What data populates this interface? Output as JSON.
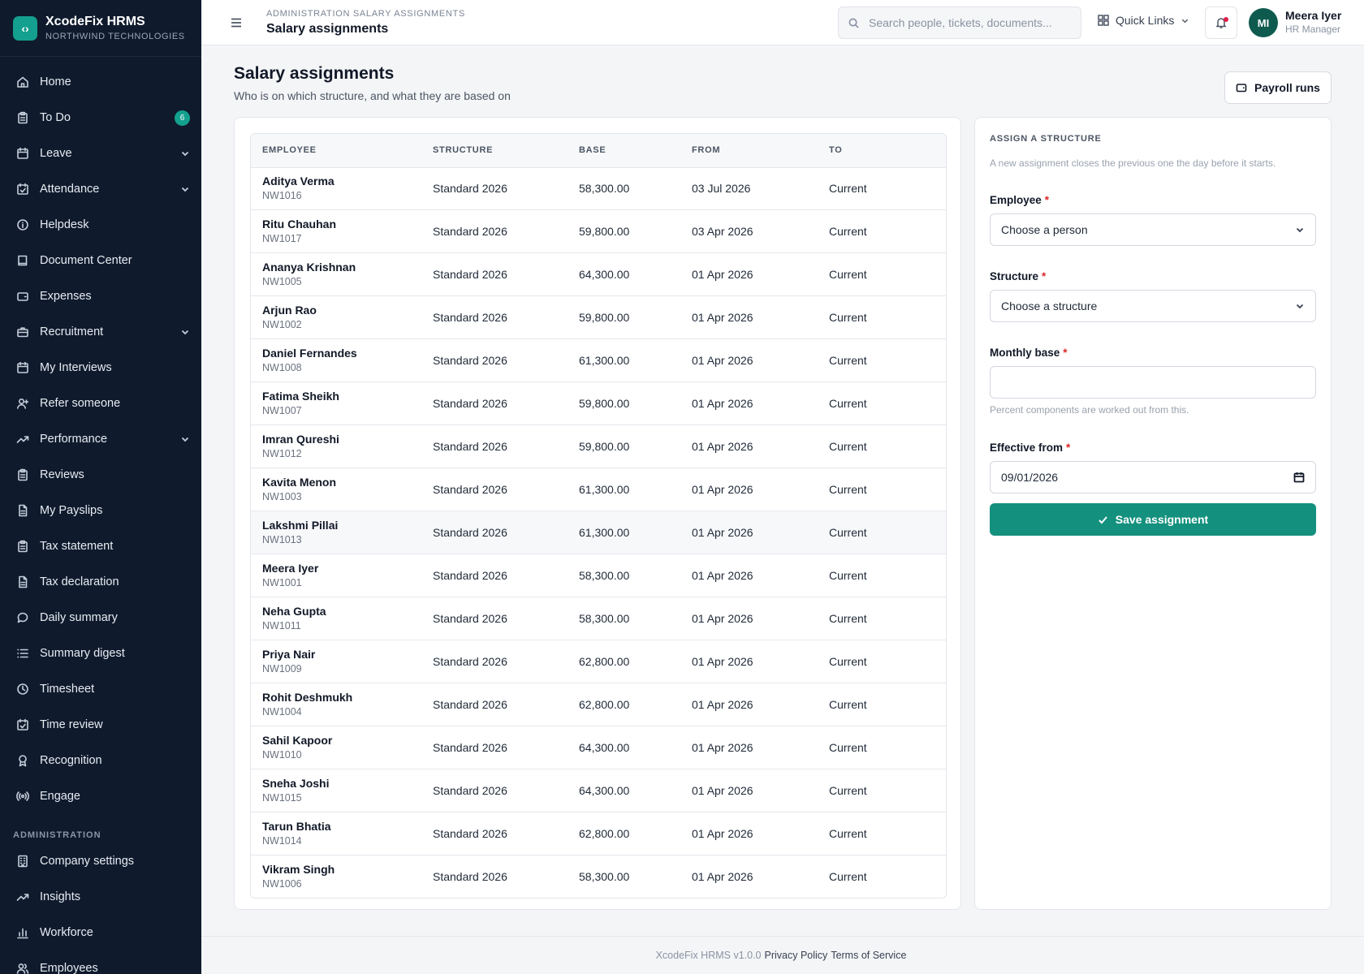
{
  "brand": {
    "name": "XcodeFix HRMS",
    "company": "NORTHWIND TECHNOLOGIES"
  },
  "sidebar": {
    "items": [
      {
        "label": "Home",
        "icon": "home-icon"
      },
      {
        "label": "To Do",
        "icon": "clipboard-icon",
        "badge": "6"
      },
      {
        "label": "Leave",
        "icon": "calendar-icon",
        "expandable": true
      },
      {
        "label": "Attendance",
        "icon": "calendar-check-icon",
        "expandable": true
      },
      {
        "label": "Helpdesk",
        "icon": "info-icon"
      },
      {
        "label": "Document Center",
        "icon": "book-icon"
      },
      {
        "label": "Expenses",
        "icon": "wallet-icon"
      },
      {
        "label": "Recruitment",
        "icon": "briefcase-icon",
        "expandable": true
      },
      {
        "label": "My Interviews",
        "icon": "calendar-icon"
      },
      {
        "label": "Refer someone",
        "icon": "user-plus-icon"
      },
      {
        "label": "Performance",
        "icon": "trending-up-icon",
        "expandable": true
      },
      {
        "label": "Reviews",
        "icon": "clipboard-icon"
      },
      {
        "label": "My Payslips",
        "icon": "file-icon"
      },
      {
        "label": "Tax statement",
        "icon": "clipboard-icon"
      },
      {
        "label": "Tax declaration",
        "icon": "file-icon"
      },
      {
        "label": "Daily summary",
        "icon": "chat-bubble-icon"
      },
      {
        "label": "Summary digest",
        "icon": "list-icon"
      },
      {
        "label": "Timesheet",
        "icon": "clock-icon"
      },
      {
        "label": "Time review",
        "icon": "calendar-check-icon"
      },
      {
        "label": "Recognition",
        "icon": "award-icon"
      },
      {
        "label": "Engage",
        "icon": "broadcast-icon"
      }
    ],
    "admin_section": "ADMINISTRATION",
    "admin_items": [
      {
        "label": "Company settings",
        "icon": "building-icon"
      },
      {
        "label": "Insights",
        "icon": "trending-up-icon"
      },
      {
        "label": "Workforce",
        "icon": "bar-chart-icon"
      },
      {
        "label": "Employees",
        "icon": "users-icon"
      }
    ]
  },
  "header": {
    "breadcrumb": "ADMINISTRATION SALARY ASSIGNMENTS",
    "title": "Salary assignments",
    "search_placeholder": "Search people, tickets, documents...",
    "quick_links": "Quick Links",
    "user": {
      "initials": "MI",
      "name": "Meera Iyer",
      "role": "HR Manager"
    }
  },
  "main": {
    "title": "Salary assignments",
    "subtitle": "Who is on which structure, and what they are based on",
    "payroll_button": "Payroll runs",
    "table": {
      "columns": [
        "EMPLOYEE",
        "STRUCTURE",
        "BASE",
        "FROM",
        "TO"
      ],
      "rows": [
        {
          "name": "Aditya Verma",
          "id": "NW1016",
          "structure": "Standard 2026",
          "base": "58,300.00",
          "from": "03 Jul 2026",
          "to": "Current"
        },
        {
          "name": "Ritu Chauhan",
          "id": "NW1017",
          "structure": "Standard 2026",
          "base": "59,800.00",
          "from": "03 Apr 2026",
          "to": "Current"
        },
        {
          "name": "Ananya Krishnan",
          "id": "NW1005",
          "structure": "Standard 2026",
          "base": "64,300.00",
          "from": "01 Apr 2026",
          "to": "Current"
        },
        {
          "name": "Arjun Rao",
          "id": "NW1002",
          "structure": "Standard 2026",
          "base": "59,800.00",
          "from": "01 Apr 2026",
          "to": "Current"
        },
        {
          "name": "Daniel Fernandes",
          "id": "NW1008",
          "structure": "Standard 2026",
          "base": "61,300.00",
          "from": "01 Apr 2026",
          "to": "Current"
        },
        {
          "name": "Fatima Sheikh",
          "id": "NW1007",
          "structure": "Standard 2026",
          "base": "59,800.00",
          "from": "01 Apr 2026",
          "to": "Current"
        },
        {
          "name": "Imran Qureshi",
          "id": "NW1012",
          "structure": "Standard 2026",
          "base": "59,800.00",
          "from": "01 Apr 2026",
          "to": "Current"
        },
        {
          "name": "Kavita Menon",
          "id": "NW1003",
          "structure": "Standard 2026",
          "base": "61,300.00",
          "from": "01 Apr 2026",
          "to": "Current"
        },
        {
          "name": "Lakshmi Pillai",
          "id": "NW1013",
          "structure": "Standard 2026",
          "base": "61,300.00",
          "from": "01 Apr 2026",
          "to": "Current"
        },
        {
          "name": "Meera Iyer",
          "id": "NW1001",
          "structure": "Standard 2026",
          "base": "58,300.00",
          "from": "01 Apr 2026",
          "to": "Current"
        },
        {
          "name": "Neha Gupta",
          "id": "NW1011",
          "structure": "Standard 2026",
          "base": "58,300.00",
          "from": "01 Apr 2026",
          "to": "Current"
        },
        {
          "name": "Priya Nair",
          "id": "NW1009",
          "structure": "Standard 2026",
          "base": "62,800.00",
          "from": "01 Apr 2026",
          "to": "Current"
        },
        {
          "name": "Rohit Deshmukh",
          "id": "NW1004",
          "structure": "Standard 2026",
          "base": "62,800.00",
          "from": "01 Apr 2026",
          "to": "Current"
        },
        {
          "name": "Sahil Kapoor",
          "id": "NW1010",
          "structure": "Standard 2026",
          "base": "64,300.00",
          "from": "01 Apr 2026",
          "to": "Current"
        },
        {
          "name": "Sneha Joshi",
          "id": "NW1015",
          "structure": "Standard 2026",
          "base": "64,300.00",
          "from": "01 Apr 2026",
          "to": "Current"
        },
        {
          "name": "Tarun Bhatia",
          "id": "NW1014",
          "structure": "Standard 2026",
          "base": "62,800.00",
          "from": "01 Apr 2026",
          "to": "Current"
        },
        {
          "name": "Vikram Singh",
          "id": "NW1006",
          "structure": "Standard 2026",
          "base": "58,300.00",
          "from": "01 Apr 2026",
          "to": "Current"
        }
      ]
    }
  },
  "form": {
    "title": "ASSIGN A STRUCTURE",
    "note": "A new assignment closes the previous one the day before it starts.",
    "employee_label": "Employee",
    "employee_placeholder": "Choose a person",
    "structure_label": "Structure",
    "structure_placeholder": "Choose a structure",
    "base_label": "Monthly base",
    "base_value": "",
    "base_help": "Percent components are worked out from this.",
    "date_label": "Effective from",
    "date_value": "09/01/2026",
    "save_label": "Save assignment",
    "required_mark": "*"
  },
  "footer": {
    "version": "XcodeFix HRMS v1.0.0",
    "privacy": "Privacy Policy",
    "terms": "Terms of Service"
  },
  "colors": {
    "sidebar_bg": "#0f1b2d",
    "accent": "#14907e",
    "required": "#dc2626"
  }
}
